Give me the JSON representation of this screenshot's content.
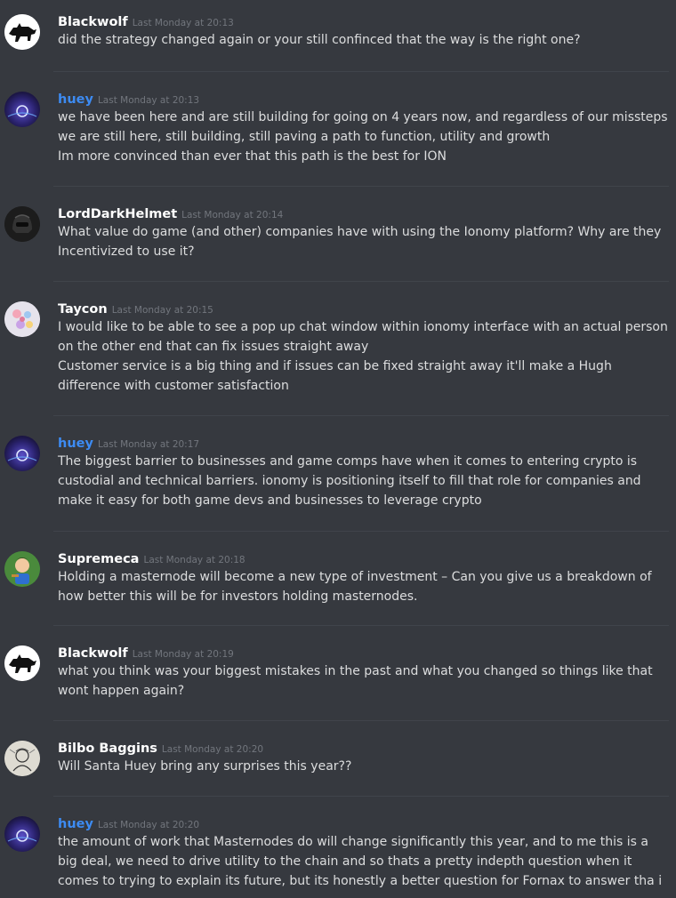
{
  "messages": [
    {
      "author": "Blackwolf",
      "timestamp": "Last Monday at 20:13",
      "avatar_icon": "wolf-icon",
      "lines": [
        "did the strategy changed again or your still confinced that the way is the right one?"
      ]
    },
    {
      "author": "huey",
      "timestamp": "Last Monday at 20:13",
      "avatar_icon": "ion-orb-icon",
      "lines": [
        "we have been here and are still building for going on 4 years now, and regardless of our missteps we are still here, still building, still paving a path to function, utility and growth",
        "Im more convinced than ever that this path is the best for ION"
      ]
    },
    {
      "author": "LordDarkHelmet",
      "timestamp": "Last Monday at 20:14",
      "avatar_icon": "helmet-icon",
      "lines": [
        "What value do game (and other) companies have with using the Ionomy platform? Why are they Incentivized to use it?"
      ]
    },
    {
      "author": "Taycon",
      "timestamp": "Last Monday at 20:15",
      "avatar_icon": "flower-icon",
      "lines": [
        "I would like to be able to see a pop up chat window within ionomy interface with an actual person on the other end that can fix issues straight away",
        "Customer service is a big thing and if issues can be fixed straight away it'll make a Hugh difference with customer satisfaction"
      ]
    },
    {
      "author": "huey",
      "timestamp": "Last Monday at 20:17",
      "avatar_icon": "ion-orb-icon",
      "lines": [
        "The biggest barrier to businesses and game comps have when it comes to entering crypto is custodial and technical barriers. ionomy is positioning itself to fill that role for companies and make it easy for both game devs and businesses to leverage crypto"
      ]
    },
    {
      "author": "Supremeca",
      "timestamp": "Last Monday at 20:18",
      "avatar_icon": "cartoon-character-icon",
      "lines": [
        "Holding a masternode will become a new type of investment – Can you give us a breakdown of how better this will be for investors holding masternodes."
      ]
    },
    {
      "author": "Blackwolf",
      "timestamp": "Last Monday at 20:19",
      "avatar_icon": "wolf-icon",
      "lines": [
        "what you think was your biggest mistakes in the past and what you changed so things like that wont happen again?"
      ]
    },
    {
      "author": "Bilbo Baggins",
      "timestamp": "Last Monday at 20:20",
      "avatar_icon": "sketch-portrait-icon",
      "lines": [
        "Will Santa Huey bring any surprises this year??"
      ]
    },
    {
      "author": "huey",
      "timestamp": "Last Monday at 20:20",
      "avatar_icon": "ion-orb-icon",
      "lines": [
        "the amount of work that Masternodes do will change significantly this year, and to me this is a big deal, we need to drive utility to the chain and so thats a pretty indepth question when it comes to trying to explain its future, but its honestly a better question for Fornax to answer tha i"
      ]
    }
  ],
  "colors": {
    "background": "#36393f",
    "username": "#ffffff",
    "username_huey": "#3d8bf2",
    "timestamp": "#72767d",
    "text": "#dcddde",
    "separator": "#40444b"
  }
}
